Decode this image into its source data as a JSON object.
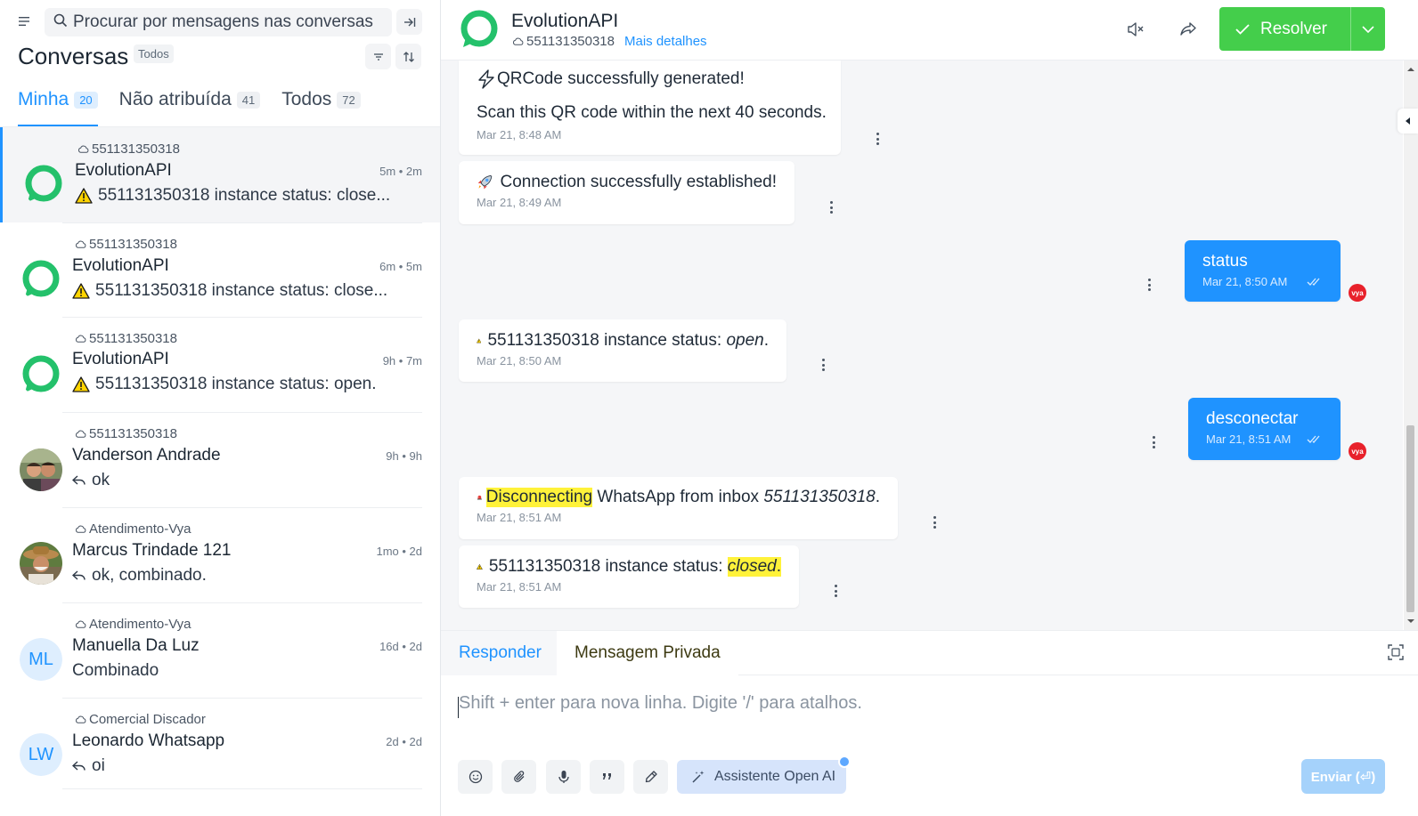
{
  "sidebar": {
    "search_placeholder": "Procurar por mensagens nas conversas",
    "title": "Conversas",
    "filter_badge": "Todos",
    "tabs": [
      {
        "label": "Minha",
        "count": "20"
      },
      {
        "label": "Não atribuída",
        "count": "41"
      },
      {
        "label": "Todos",
        "count": "72"
      }
    ],
    "conversations": [
      {
        "inbox": "551131350318",
        "name": "EvolutionAPI",
        "time": "5m • 2m",
        "message": "551131350318 instance status: close...",
        "avatar": "evolution-logo",
        "msg_icon": "warning-icon"
      },
      {
        "inbox": "551131350318",
        "name": "EvolutionAPI",
        "time": "6m • 5m",
        "message": "551131350318 instance status: close...",
        "avatar": "evolution-logo",
        "msg_icon": "warning-icon"
      },
      {
        "inbox": "551131350318",
        "name": "EvolutionAPI",
        "time": "9h • 7m",
        "message": "551131350318 instance status: open.",
        "avatar": "evolution-logo",
        "msg_icon": "warning-icon"
      },
      {
        "inbox": "551131350318",
        "name": "Vanderson Andrade",
        "time": "9h • 9h",
        "message": "ok",
        "avatar": "photo",
        "msg_icon": "reply-icon"
      },
      {
        "inbox": "Atendimento-Vya",
        "name": "Marcus Trindade 121",
        "time": "1mo • 2d",
        "message": "ok, combinado.",
        "avatar": "photo",
        "msg_icon": "reply-icon"
      },
      {
        "inbox": "Atendimento-Vya",
        "name": "Manuella Da Luz",
        "time": "16d • 2d",
        "message": "Combinado",
        "avatar": "ML",
        "msg_icon": ""
      },
      {
        "inbox": "Comercial Discador",
        "name": "Leonardo Whatsapp",
        "time": "2d • 2d",
        "message": "oi",
        "avatar": "LW",
        "msg_icon": "reply-icon"
      }
    ]
  },
  "header": {
    "name": "EvolutionAPI",
    "phone": "551131350318",
    "details_link": "Mais detalhes",
    "resolve_label": "Resolver"
  },
  "messages": [
    {
      "line1": "QRCode successfully generated!",
      "line2": "Scan this QR code within the next 40 seconds.",
      "time": "Mar 21, 8:48 AM",
      "dir": "in"
    },
    {
      "text": "Connection successfully established!",
      "time": "Mar 21, 8:49 AM",
      "dir": "in"
    },
    {
      "text": "status",
      "time": "Mar 21, 8:50 AM",
      "dir": "out",
      "agent": "vya"
    },
    {
      "prefix": "551131350318 instance status: ",
      "emph": "open",
      "suffix": ".",
      "time": "Mar 21, 8:50 AM",
      "dir": "in"
    },
    {
      "text": "desconectar",
      "time": "Mar 21, 8:51 AM",
      "dir": "out",
      "agent": "vya"
    },
    {
      "highlight": "Disconnecting",
      "middle": " WhatsApp from inbox ",
      "emph": "551131350318",
      "suffix": ".",
      "time": "Mar 21, 8:51 AM",
      "dir": "in"
    },
    {
      "prefix": "551131350318 instance status: ",
      "emph": "closed",
      "suffix": ".",
      "time": "Mar 21, 8:51 AM",
      "dir": "in"
    }
  ],
  "composer": {
    "tab_reply": "Responder",
    "tab_private": "Mensagem Privada",
    "placeholder": "Shift + enter para nova linha. Digite '/' para atalhos.",
    "ai_label": "Assistente Open AI",
    "send_label": "Enviar (⏎)"
  },
  "colors": {
    "accent": "#1f93ff",
    "resolve": "#44ce4b",
    "agent_badge": "#e8212b",
    "highlight": "#fff23a"
  }
}
